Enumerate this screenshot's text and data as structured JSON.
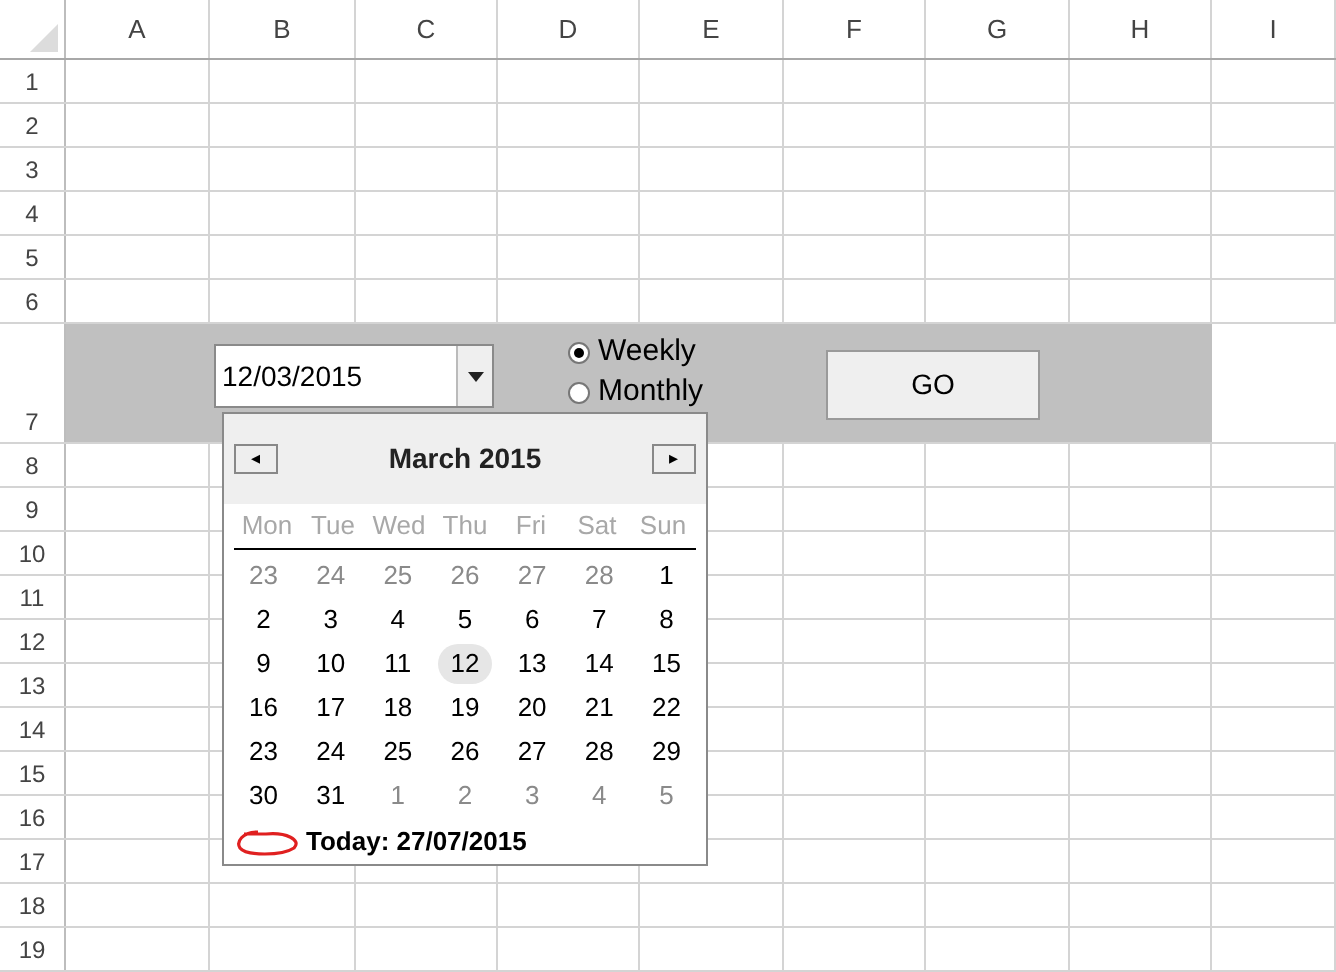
{
  "columns": [
    "A",
    "B",
    "C",
    "D",
    "E",
    "F",
    "G",
    "H",
    "I"
  ],
  "rows": [
    "1",
    "2",
    "3",
    "4",
    "5",
    "6",
    "7",
    "8",
    "9",
    "10",
    "11",
    "12",
    "13",
    "14",
    "15",
    "16",
    "17",
    "18",
    "19"
  ],
  "form": {
    "date_field": {
      "value": "12/03/2015"
    },
    "options": [
      {
        "label": "Weekly",
        "selected": true
      },
      {
        "label": "Monthly",
        "selected": false
      }
    ],
    "button": "GO"
  },
  "calendar": {
    "title": "March 2015",
    "prev": "◂",
    "next": "▸",
    "weekdays": [
      "Mon",
      "Tue",
      "Wed",
      "Thu",
      "Fri",
      "Sat",
      "Sun"
    ],
    "weeks": [
      [
        {
          "day": "23",
          "muted": true,
          "selected": false
        },
        {
          "day": "24",
          "muted": true,
          "selected": false
        },
        {
          "day": "25",
          "muted": true,
          "selected": false
        },
        {
          "day": "26",
          "muted": true,
          "selected": false
        },
        {
          "day": "27",
          "muted": true,
          "selected": false
        },
        {
          "day": "28",
          "muted": true,
          "selected": false
        },
        {
          "day": "1",
          "muted": false,
          "selected": false
        }
      ],
      [
        {
          "day": "2",
          "muted": false,
          "selected": false
        },
        {
          "day": "3",
          "muted": false,
          "selected": false
        },
        {
          "day": "4",
          "muted": false,
          "selected": false
        },
        {
          "day": "5",
          "muted": false,
          "selected": false
        },
        {
          "day": "6",
          "muted": false,
          "selected": false
        },
        {
          "day": "7",
          "muted": false,
          "selected": false
        },
        {
          "day": "8",
          "muted": false,
          "selected": false
        }
      ],
      [
        {
          "day": "9",
          "muted": false,
          "selected": false
        },
        {
          "day": "10",
          "muted": false,
          "selected": false
        },
        {
          "day": "11",
          "muted": false,
          "selected": false
        },
        {
          "day": "12",
          "muted": false,
          "selected": true
        },
        {
          "day": "13",
          "muted": false,
          "selected": false
        },
        {
          "day": "14",
          "muted": false,
          "selected": false
        },
        {
          "day": "15",
          "muted": false,
          "selected": false
        }
      ],
      [
        {
          "day": "16",
          "muted": false,
          "selected": false
        },
        {
          "day": "17",
          "muted": false,
          "selected": false
        },
        {
          "day": "18",
          "muted": false,
          "selected": false
        },
        {
          "day": "19",
          "muted": false,
          "selected": false
        },
        {
          "day": "20",
          "muted": false,
          "selected": false
        },
        {
          "day": "21",
          "muted": false,
          "selected": false
        },
        {
          "day": "22",
          "muted": false,
          "selected": false
        }
      ],
      [
        {
          "day": "23",
          "muted": false,
          "selected": false
        },
        {
          "day": "24",
          "muted": false,
          "selected": false
        },
        {
          "day": "25",
          "muted": false,
          "selected": false
        },
        {
          "day": "26",
          "muted": false,
          "selected": false
        },
        {
          "day": "27",
          "muted": false,
          "selected": false
        },
        {
          "day": "28",
          "muted": false,
          "selected": false
        },
        {
          "day": "29",
          "muted": false,
          "selected": false
        }
      ],
      [
        {
          "day": "30",
          "muted": false,
          "selected": false
        },
        {
          "day": "31",
          "muted": false,
          "selected": false
        },
        {
          "day": "1",
          "muted": true,
          "selected": false
        },
        {
          "day": "2",
          "muted": true,
          "selected": false
        },
        {
          "day": "3",
          "muted": true,
          "selected": false
        },
        {
          "day": "4",
          "muted": true,
          "selected": false
        },
        {
          "day": "5",
          "muted": true,
          "selected": false
        }
      ]
    ],
    "today": "Today: 27/07/2015"
  }
}
